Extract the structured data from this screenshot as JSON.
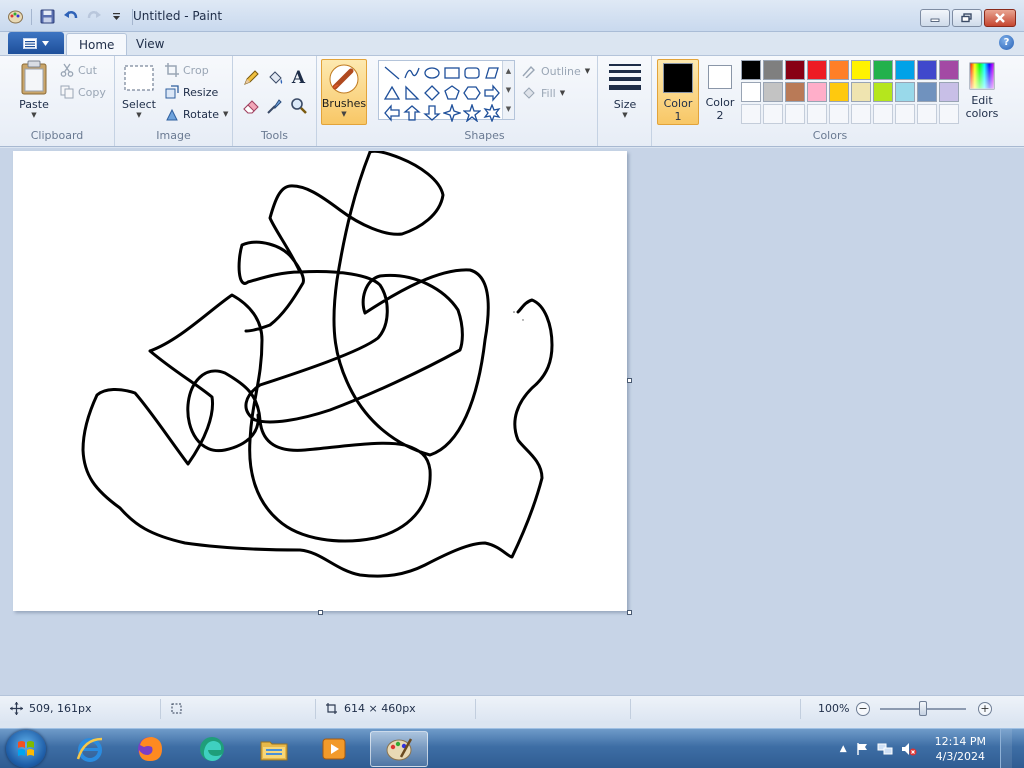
{
  "window": {
    "title": "Untitled - Paint"
  },
  "ribbon_tabs": [
    {
      "label": "Home",
      "active": true
    },
    {
      "label": "View",
      "active": false
    }
  ],
  "clipboard": {
    "paste_label": "Paste",
    "cut_label": "Cut",
    "copy_label": "Copy",
    "group_label": "Clipboard"
  },
  "image": {
    "select_label": "Select",
    "crop_label": "Crop",
    "resize_label": "Resize",
    "rotate_label": "Rotate",
    "group_label": "Image"
  },
  "tools": {
    "group_label": "Tools",
    "text_glyph": "A"
  },
  "brushes": {
    "label": "Brushes"
  },
  "shapes": {
    "outline_label": "Outline",
    "fill_label": "Fill",
    "group_label": "Shapes"
  },
  "size": {
    "label": "Size"
  },
  "colors": {
    "color1_label": "Color",
    "color1_num": "1",
    "color1_value": "#000000",
    "color2_label": "Color",
    "color2_num": "2",
    "color2_value": "#ffffff",
    "edit_label_1": "Edit",
    "edit_label_2": "colors",
    "group_label": "Colors",
    "palette_row1": [
      "#000000",
      "#7f7f7f",
      "#880015",
      "#ed1c24",
      "#ff7f27",
      "#fff200",
      "#22b14c",
      "#00a2e8",
      "#3f48cc",
      "#a349a4"
    ],
    "palette_row2": [
      "#ffffff",
      "#c3c3c3",
      "#b97a57",
      "#ffaec9",
      "#ffc90e",
      "#efe4b0",
      "#b5e61d",
      "#99d9ea",
      "#7092be",
      "#c8bfe7"
    ]
  },
  "status": {
    "cursor_pos": "509, 161px",
    "canvas_size": "614 × 460px",
    "zoom": "100%",
    "zoom_level": 100
  },
  "taskbar": {
    "time": "12:14 PM",
    "date": "4/3/2024"
  },
  "accent": "#1e4f9a"
}
